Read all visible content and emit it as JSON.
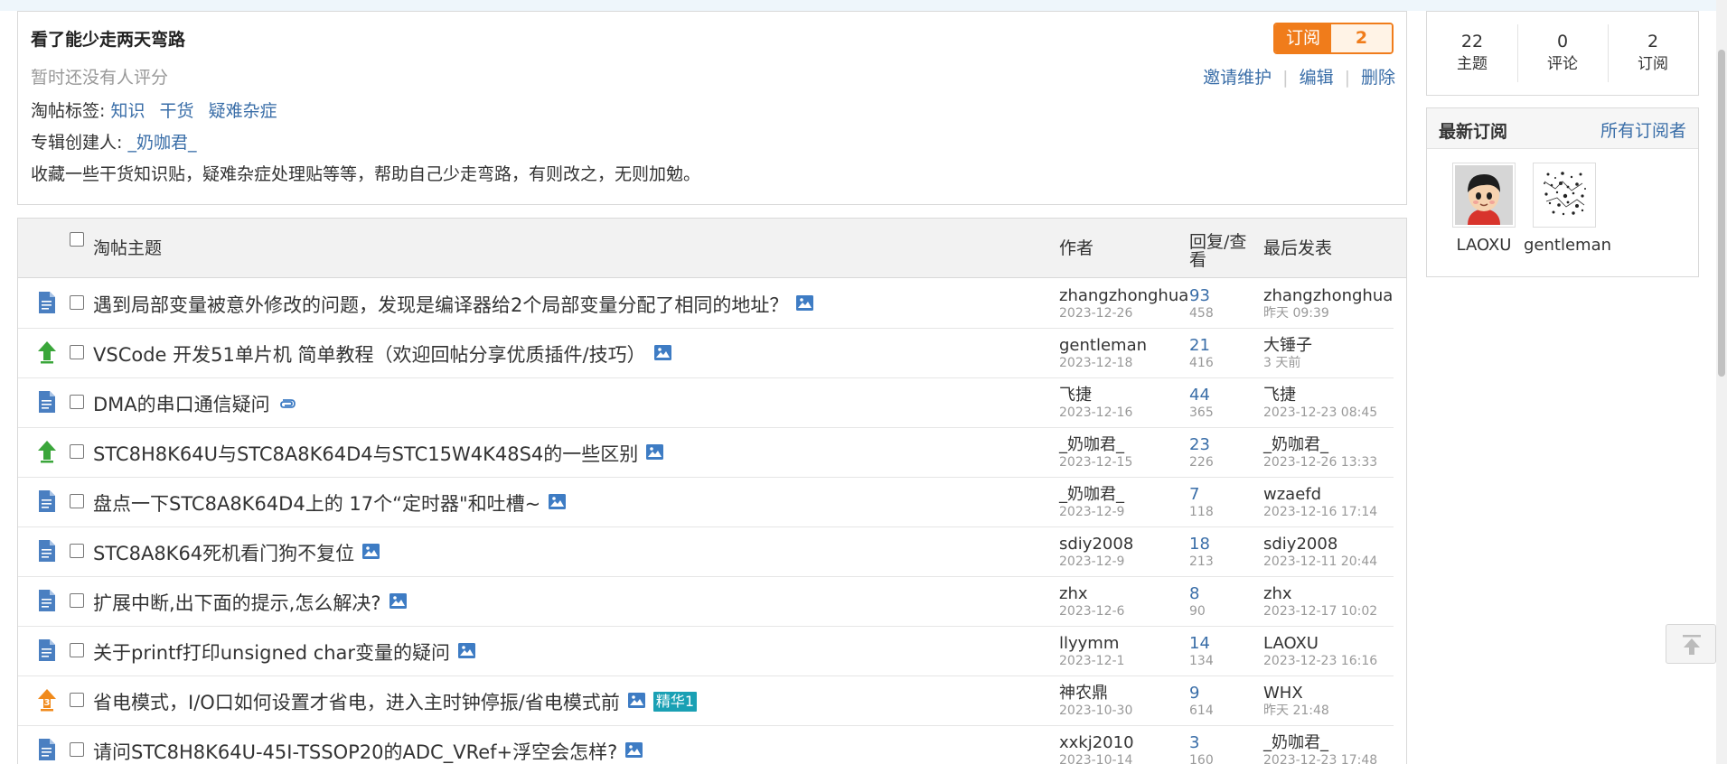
{
  "album": {
    "title": "看了能少走两天弯路",
    "rating_text": "暂时还没有人评分",
    "tags_label": "淘帖标签:",
    "tags": [
      "知识",
      "干货",
      "疑难杂症"
    ],
    "creator_label": "专辑创建人:",
    "creator": "_奶咖君_",
    "description": "收藏一些干货知识贴，疑难杂症处理贴等等，帮助自己少走弯路，有则改之，无则加勉。",
    "subscribe_label": "订阅",
    "subscribe_count": "2",
    "actions": [
      "邀请维护",
      "编辑",
      "删除"
    ]
  },
  "table": {
    "headers": {
      "subject": "淘帖主题",
      "author": "作者",
      "replies": "回复/查看",
      "last": "最后发表"
    },
    "rows": [
      {
        "type": "normal",
        "subject": "遇到局部变量被意外修改的问题，发现是编译器给2个局部变量分配了相同的地址？",
        "attachment": "image",
        "author": "zhangzhonghua",
        "date": "2023-12-26",
        "replies": "93",
        "views": "458",
        "last_user": "zhangzhonghua",
        "last_time": "昨天 09:39"
      },
      {
        "type": "up",
        "subject": "VSCode 开发51单片机 简单教程（欢迎回帖分享优质插件/技巧）",
        "attachment": "image",
        "author": "gentleman",
        "date": "2023-12-18",
        "replies": "21",
        "views": "416",
        "last_user": "大锤子",
        "last_time": "3 天前"
      },
      {
        "type": "normal",
        "subject": "DMA的串口通信疑问",
        "attachment": "clip",
        "author": "飞捷",
        "date": "2023-12-16",
        "replies": "44",
        "views": "365",
        "last_user": "飞捷",
        "last_time": "2023-12-23 08:45"
      },
      {
        "type": "up",
        "subject": "STC8H8K64U与STC8A8K64D4与STC15W4K48S4的一些区别",
        "attachment": "image",
        "author": "_奶咖君_",
        "date": "2023-12-15",
        "replies": "23",
        "views": "226",
        "last_user": "_奶咖君_",
        "last_time": "2023-12-26 13:33"
      },
      {
        "type": "normal",
        "subject": "盘点一下STC8A8K64D4上的 17个“定时器\"和吐槽~",
        "attachment": "image",
        "author": "_奶咖君_",
        "date": "2023-12-9",
        "replies": "7",
        "views": "118",
        "last_user": "wzaefd",
        "last_time": "2023-12-16 17:14"
      },
      {
        "type": "normal",
        "subject": "STC8A8K64死机看门狗不复位",
        "attachment": "image",
        "author": "sdiy2008",
        "date": "2023-12-9",
        "replies": "18",
        "views": "213",
        "last_user": "sdiy2008",
        "last_time": "2023-12-11 20:44"
      },
      {
        "type": "normal",
        "subject": "扩展中断,出下面的提示,怎么解决?",
        "attachment": "image",
        "author": "zhx",
        "date": "2023-12-6",
        "replies": "8",
        "views": "90",
        "last_user": "zhx",
        "last_time": "2023-12-17 10:02"
      },
      {
        "type": "normal",
        "subject": "关于printf打印unsigned char变量的疑问",
        "attachment": "image",
        "author": "llyymm",
        "date": "2023-12-1",
        "replies": "14",
        "views": "134",
        "last_user": "LAOXU",
        "last_time": "2023-12-23 16:16"
      },
      {
        "type": "hot3",
        "subject": "省电模式，I/O口如何设置才省电，进入主时钟停振/省电模式前",
        "attachment": "image",
        "badge": "精华1",
        "author": "神农鼎",
        "date": "2023-10-30",
        "replies": "9",
        "views": "614",
        "last_user": "WHX",
        "last_time": "昨天 21:48"
      },
      {
        "type": "normal",
        "subject": "请问STC8H8K64U-45I-TSSOP20的ADC_VRef+浮空会怎样?",
        "attachment": "image",
        "author": "xxkj2010",
        "date": "2023-10-14",
        "replies": "3",
        "views": "160",
        "last_user": "_奶咖君_",
        "last_time": "2023-12-23 17:48"
      }
    ]
  },
  "sidebar": {
    "stats": [
      {
        "num": "22",
        "label": "主题"
      },
      {
        "num": "0",
        "label": "评论"
      },
      {
        "num": "2",
        "label": "订阅"
      }
    ],
    "subs_title": "最新订阅",
    "all_subs": "所有订阅者",
    "subscribers": [
      {
        "name": "LAOXU",
        "avatar": "cartoon-boy-avatar"
      },
      {
        "name": "gentleman",
        "avatar": "sketch-avatar"
      }
    ]
  },
  "colors": {
    "accent_orange": "#f07c1b",
    "link_blue": "#3a6ea8",
    "icon_blue": "#4a7fc1",
    "up_green": "#3aa63a",
    "badge_teal": "#1aa0b4"
  }
}
